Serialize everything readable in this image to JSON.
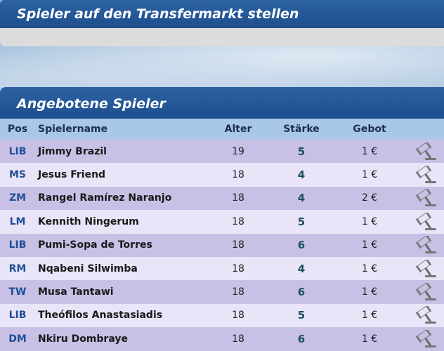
{
  "top_panel": {
    "title": "Spieler auf den Transfermarkt stellen"
  },
  "offered": {
    "title": "Angebotene Spieler",
    "columns": {
      "pos": "Pos",
      "name": "Spielername",
      "age": "Alter",
      "strength": "Stärke",
      "bid": "Gebot"
    },
    "rows": [
      {
        "pos": "LIB",
        "name": "Jimmy Brazil",
        "age": "19",
        "strength": "5",
        "bid": "1 €"
      },
      {
        "pos": "MS",
        "name": "Jesus Friend",
        "age": "18",
        "strength": "4",
        "bid": "1 €"
      },
      {
        "pos": "ZM",
        "name": "Rangel Ramírez Naranjo",
        "age": "18",
        "strength": "4",
        "bid": "2 €"
      },
      {
        "pos": "LM",
        "name": "Kennith Ningerum",
        "age": "18",
        "strength": "5",
        "bid": "1 €"
      },
      {
        "pos": "LIB",
        "name": "Pumi-Sopa de Torres",
        "age": "18",
        "strength": "6",
        "bid": "1 €"
      },
      {
        "pos": "RM",
        "name": "Nqabeni Silwimba",
        "age": "18",
        "strength": "4",
        "bid": "1 €"
      },
      {
        "pos": "TW",
        "name": "Musa Tantawi",
        "age": "18",
        "strength": "6",
        "bid": "1 €"
      },
      {
        "pos": "LIB",
        "name": "Theófilos Anastasiadis",
        "age": "18",
        "strength": "5",
        "bid": "1 €"
      },
      {
        "pos": "DM",
        "name": "Nkiru Dombraye",
        "age": "18",
        "strength": "6",
        "bid": "1 €"
      }
    ],
    "action_icon": "gavel-icon"
  },
  "colors": {
    "header_blue": "#1e4f8e",
    "row_odd": "#c9c0e6",
    "row_even": "#e9e4f7",
    "column_header": "#a9c7e8",
    "pos_text": "#1f4f96"
  }
}
